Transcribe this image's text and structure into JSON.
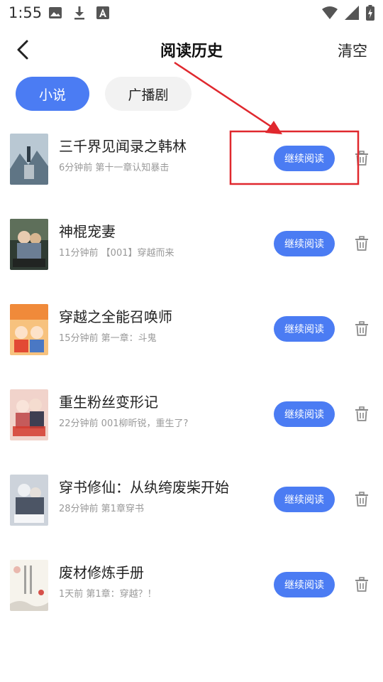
{
  "status_bar": {
    "time": "1:55"
  },
  "header": {
    "back_icon": "chevron-left-icon",
    "title": "阅读历史",
    "clear_label": "清空"
  },
  "tabs": [
    {
      "label": "小说",
      "active": true
    },
    {
      "label": "广播剧",
      "active": false
    }
  ],
  "history": [
    {
      "title": "三千界见闻录之韩林",
      "meta": "6分钟前 第十一章认知暴击",
      "continue_label": "继续阅读",
      "cover_palette": [
        "#9fb4c4",
        "#4d6272"
      ]
    },
    {
      "title": "神棍宠妻",
      "meta": "11分钟前 【001】穿越而来",
      "continue_label": "继续阅读",
      "cover_palette": [
        "#3b4a3a",
        "#c9a27a"
      ]
    },
    {
      "title": "穿越之全能召唤师",
      "meta": "15分钟前 第一章：斗鬼",
      "continue_label": "继续阅读",
      "cover_palette": [
        "#f5b064",
        "#e04a2a"
      ]
    },
    {
      "title": "重生粉丝变形记",
      "meta": "22分钟前 001柳昕锐，重生了?",
      "continue_label": "继续阅读",
      "cover_palette": [
        "#f0c9c2",
        "#b43a3a"
      ]
    },
    {
      "title": "穿书修仙：从纨绔废柴开始",
      "meta": "28分钟前 第1章穿书",
      "continue_label": "继续阅读",
      "cover_palette": [
        "#c9ced6",
        "#3d4452"
      ]
    },
    {
      "title": "废材修炼手册",
      "meta": "1天前 第1章：穿越？！",
      "continue_label": "继续阅读",
      "cover_palette": [
        "#f4f1ea",
        "#c7a9a0"
      ]
    }
  ],
  "colors": {
    "accent": "#4b7cf3",
    "annotation": "#e0282e"
  }
}
